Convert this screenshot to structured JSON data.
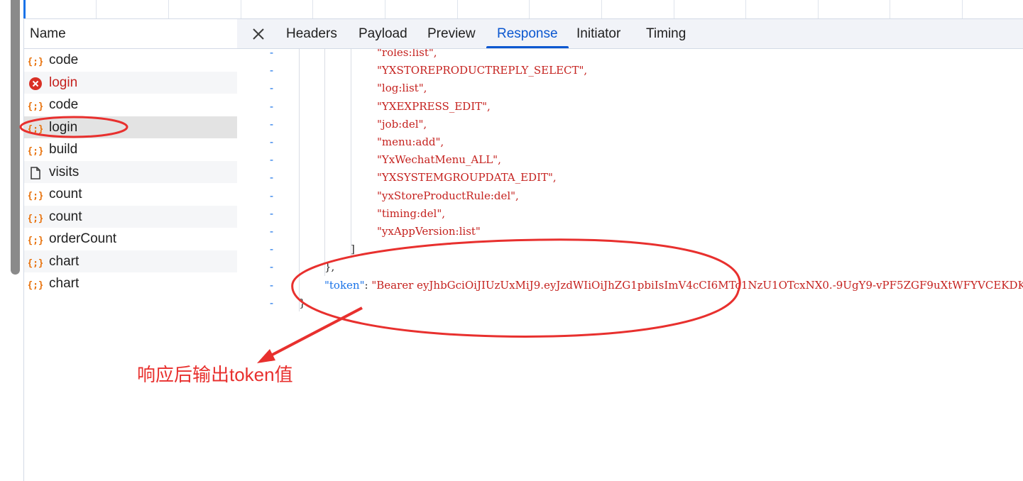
{
  "network_panel": {
    "name_column_header": "Name",
    "requests": [
      {
        "name": "code",
        "icon": "json-braces-icon",
        "status": "ok"
      },
      {
        "name": "login",
        "icon": "error-circle-icon",
        "status": "error"
      },
      {
        "name": "code",
        "icon": "json-braces-icon",
        "status": "ok"
      },
      {
        "name": "login",
        "icon": "json-braces-icon",
        "status": "selected"
      },
      {
        "name": "build",
        "icon": "json-braces-icon",
        "status": "ok"
      },
      {
        "name": "visits",
        "icon": "document-icon",
        "status": "ok"
      },
      {
        "name": "count",
        "icon": "json-braces-icon",
        "status": "ok"
      },
      {
        "name": "count",
        "icon": "json-braces-icon",
        "status": "ok"
      },
      {
        "name": "orderCount",
        "icon": "json-braces-icon",
        "status": "ok"
      },
      {
        "name": "chart",
        "icon": "json-braces-icon",
        "status": "ok"
      },
      {
        "name": "chart",
        "icon": "json-braces-icon",
        "status": "ok"
      }
    ]
  },
  "detail_panel": {
    "close_icon": "close-icon",
    "tabs": [
      {
        "label": "Headers"
      },
      {
        "label": "Payload"
      },
      {
        "label": "Preview"
      },
      {
        "label": "Response",
        "active": true
      },
      {
        "label": "Initiator"
      },
      {
        "label": "Timing"
      }
    ],
    "response_lines": [
      "\"roles:list\",",
      "\"YXSTOREPRODUCTREPLY_SELECT\",",
      "\"log:list\",",
      "\"YXEXPRESS_EDIT\",",
      "\"job:del\",",
      "\"menu:add\",",
      "\"YxWechatMenu_ALL\",",
      "\"YXSYSTEMGROUPDATA_EDIT\",",
      "\"yxStoreProductRule:del\",",
      "\"timing:del\",",
      "\"yxAppVersion:list\""
    ],
    "closing_bracket": "]",
    "closing_brace_comma": "},",
    "token_key": "\"token\"",
    "token_separator": ": ",
    "token_value": "\"Bearer eyJhbGciOiJIUzUxMiJ9.eyJzdWIiOiJhZG1pbiIsImV4cCI6MTc1NzU1OTcxNX0.-9UgY9-vPF5ZGF9uXtWFYVCEKDK",
    "final_brace": "}",
    "gutter_marker": "-"
  },
  "annotation": {
    "text": "响应后输出token值",
    "color": "#e8302e"
  },
  "colors": {
    "accent": "#0b57d0",
    "string": "#c5221f",
    "key": "#1a73e8"
  }
}
